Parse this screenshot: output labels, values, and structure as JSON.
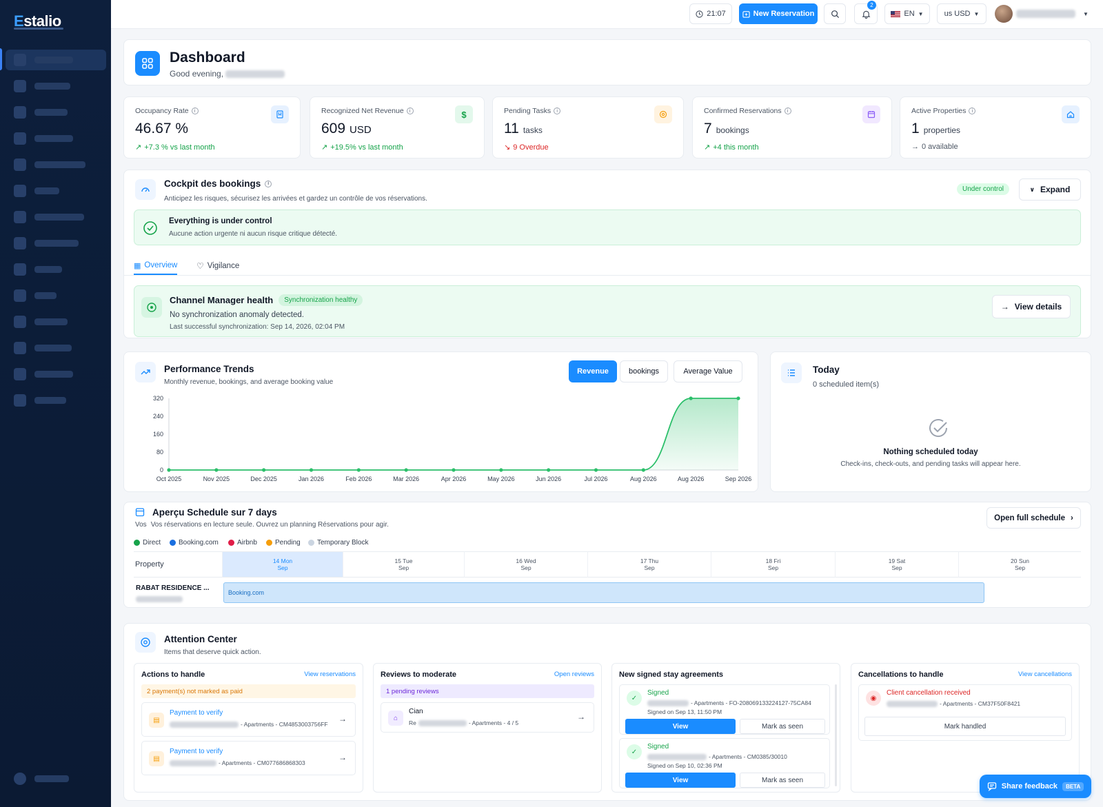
{
  "app": {
    "logo_first": "E",
    "logo_rest": "stalio"
  },
  "topbar": {
    "time": "21:07",
    "new_reservation": "New Reservation",
    "notifications_count": "2",
    "language": "EN",
    "currency": "us USD"
  },
  "header": {
    "title": "Dashboard",
    "greeting": "Good evening,"
  },
  "kpis": [
    {
      "label": "Occupancy Rate",
      "value": "46.67 %",
      "unit": "",
      "trend": "+7.3 % vs last month",
      "icon": "bookmark-icon"
    },
    {
      "label": "Recognized Net Revenue",
      "value": "609",
      "unit": "USD",
      "trend": "+19.5% vs last month",
      "icon": "dollar-icon"
    },
    {
      "label": "Pending Tasks",
      "value": "11",
      "unit": "tasks",
      "trend": "9 Overdue",
      "icon": "target-icon"
    },
    {
      "label": "Confirmed Reservations",
      "value": "7",
      "unit": "bookings",
      "trend": "+4 this month",
      "icon": "calendar-icon"
    },
    {
      "label": "Active Properties",
      "value": "1",
      "unit": "properties",
      "trend": "0 available",
      "icon": "home-icon"
    }
  ],
  "cockpit": {
    "title": "Cockpit des bookings",
    "subtitle": "Anticipez les risques, sécurisez les arrivées et gardez un contrôle de vos réservations.",
    "status_pill": "Under control",
    "expand": "Expand",
    "banner_title": "Everything is under control",
    "banner_sub": "Aucune action urgente ni aucun risque critique détecté.",
    "tabs": [
      "Overview",
      "Vigilance"
    ],
    "channel": {
      "title": "Channel Manager health",
      "pill": "Synchronization healthy",
      "line1": "No synchronization anomaly detected.",
      "line2": "Last successful synchronization: Sep 14, 2026, 02:04 PM",
      "button": "View details"
    }
  },
  "performance": {
    "title": "Performance Trends",
    "subtitle": "Monthly revenue, bookings, and average booking value",
    "toggles": [
      "Revenue",
      "bookings",
      "Average Value"
    ]
  },
  "chart_data": {
    "type": "area",
    "categories": [
      "Oct 2025",
      "Nov 2025",
      "Dec 2025",
      "Jan 2026",
      "Feb 2026",
      "Mar 2026",
      "Apr 2026",
      "May 2026",
      "Jun 2026",
      "Jul 2026",
      "Aug 2026",
      "Aug 2026",
      "Sep 2026"
    ],
    "values": [
      0,
      0,
      0,
      0,
      0,
      0,
      0,
      0,
      0,
      0,
      0,
      320,
      320
    ],
    "yticks": [
      "0",
      "80",
      "160",
      "240",
      "320"
    ],
    "ylim": [
      0,
      320
    ],
    "color": "#2bbf6a"
  },
  "today": {
    "title": "Today",
    "subtitle": "0 scheduled item(s)",
    "empty_title": "Nothing scheduled today",
    "empty_sub": "Check-ins, check-outs, and pending tasks will appear here."
  },
  "schedule": {
    "title": "Aperçu Schedule sur 7 days",
    "sub_prefix": "Vos",
    "subtitle": "Vos réservations en lecture seule. Ouvrez un planning Réservations pour agir.",
    "open": "Open full schedule",
    "legend": [
      {
        "label": "Direct",
        "color": "#16a34a"
      },
      {
        "label": "Booking.com",
        "color": "#1a6fe0"
      },
      {
        "label": "Airbnb",
        "color": "#e11d48"
      },
      {
        "label": "Pending",
        "color": "#f59e0b"
      },
      {
        "label": "Temporary Block",
        "color": "#cbd5e1"
      }
    ],
    "property_header": "Property",
    "days": [
      {
        "day": "14 Mon",
        "month": "Sep"
      },
      {
        "day": "15 Tue",
        "month": "Sep"
      },
      {
        "day": "16 Wed",
        "month": "Sep"
      },
      {
        "day": "17 Thu",
        "month": "Sep"
      },
      {
        "day": "18 Fri",
        "month": "Sep"
      },
      {
        "day": "19 Sat",
        "month": "Sep"
      },
      {
        "day": "20 Sun",
        "month": "Sep"
      }
    ],
    "property": "RABAT RESIDENCE ...",
    "booking_label": "Booking.com"
  },
  "attention": {
    "title": "Attention Center",
    "subtitle": "Items that deserve quick action.",
    "actions": {
      "title": "Actions to handle",
      "link": "View reservations",
      "warning": "2 payment(s) not marked as paid",
      "items": [
        {
          "title": "Payment to verify",
          "sub": "- Apartments - CM4853003756FF"
        },
        {
          "title": "Payment to verify",
          "sub": "- Apartments - CM077686868303"
        }
      ]
    },
    "reviews": {
      "title": "Reviews to moderate",
      "link": "Open reviews",
      "pending": "1 pending reviews",
      "item_name": "Cian",
      "item_prefix": "Re",
      "item_sub": "- Apartments - 4 / 5"
    },
    "agreements": {
      "title": "New signed stay agreements",
      "items": [
        {
          "status": "Signed",
          "ref": "- Apartments - FO-208069133224127-75CA84",
          "date": "Signed on Sep 13, 11:50 PM"
        },
        {
          "status": "Signed",
          "ref": "- Apartments - CM0385/30010",
          "date": "Signed on Sep 10, 02:36 PM"
        }
      ],
      "view": "View",
      "seen": "Mark as seen"
    },
    "cancellations": {
      "title": "Cancellations to handle",
      "link": "View cancellations",
      "item_title": "Client cancellation received",
      "item_sub": "- Apartments - CM37F50F8421",
      "button": "Mark handled"
    }
  },
  "feedback": {
    "label": "Share feedback",
    "beta": "BETA"
  }
}
